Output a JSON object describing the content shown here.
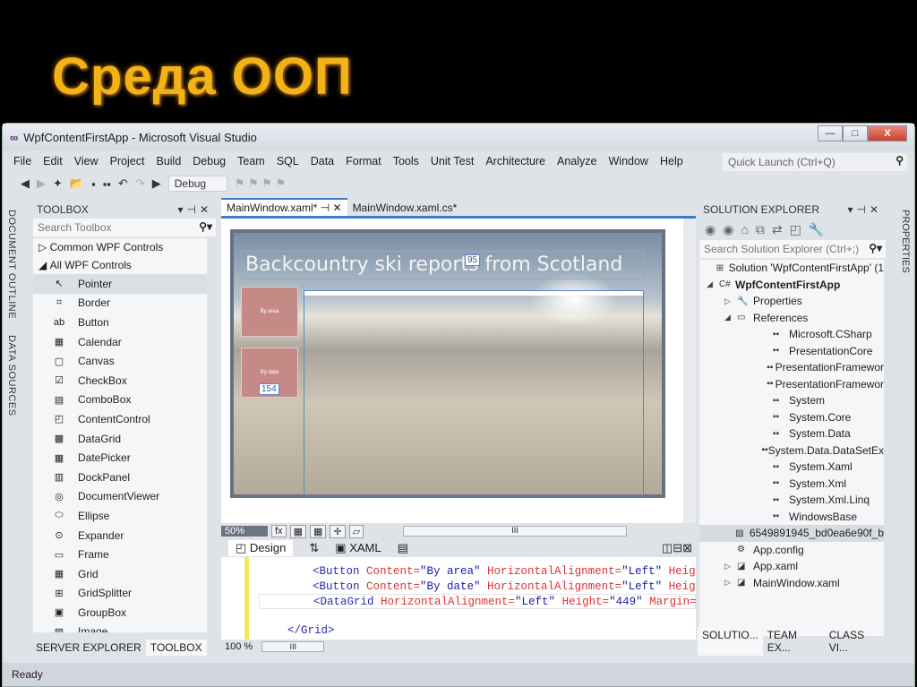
{
  "slide": {
    "title": "Среда ООП"
  },
  "window": {
    "title": "WpfContentFirstApp - Microsoft Visual Studio",
    "minimize": "—",
    "maximize": "□",
    "close": "X"
  },
  "menu": [
    "File",
    "Edit",
    "View",
    "Project",
    "Build",
    "Debug",
    "Team",
    "SQL",
    "Data",
    "Format",
    "Tools",
    "Unit Test",
    "Architecture",
    "Analyze",
    "Window",
    "Help"
  ],
  "quick_launch": {
    "placeholder": "Quick Launch (Ctrl+Q)"
  },
  "toolbar": {
    "config": "Debug"
  },
  "left_vtabs": [
    "DOCUMENT OUTLINE",
    "DATA SOURCES"
  ],
  "toolbox": {
    "title": "TOOLBOX",
    "search_placeholder": "Search Toolbox",
    "groups": [
      "Common WPF Controls",
      "All WPF Controls"
    ],
    "items": [
      {
        "label": "Pointer",
        "icon": "↖"
      },
      {
        "label": "Border",
        "icon": "⌗"
      },
      {
        "label": "Button",
        "icon": "ab"
      },
      {
        "label": "Calendar",
        "icon": "▦"
      },
      {
        "label": "Canvas",
        "icon": "▢"
      },
      {
        "label": "CheckBox",
        "icon": "☑"
      },
      {
        "label": "ComboBox",
        "icon": "▤"
      },
      {
        "label": "ContentControl",
        "icon": "◰"
      },
      {
        "label": "DataGrid",
        "icon": "▩"
      },
      {
        "label": "DatePicker",
        "icon": "▦"
      },
      {
        "label": "DockPanel",
        "icon": "▥"
      },
      {
        "label": "DocumentViewer",
        "icon": "◎"
      },
      {
        "label": "Ellipse",
        "icon": "⬭"
      },
      {
        "label": "Expander",
        "icon": "⊙"
      },
      {
        "label": "Frame",
        "icon": "▭"
      },
      {
        "label": "Grid",
        "icon": "▦"
      },
      {
        "label": "GridSplitter",
        "icon": "⊞"
      },
      {
        "label": "GroupBox",
        "icon": "▣"
      },
      {
        "label": "Image",
        "icon": "▨"
      }
    ],
    "bottom_tabs": [
      "SERVER EXPLORER",
      "TOOLBOX"
    ]
  },
  "editor": {
    "tabs": [
      "MainWindow.xaml*",
      "MainWindow.xaml.cs*"
    ],
    "design": {
      "heading": "Backcountry ski reports from Scotland",
      "buttons": [
        "By area",
        "By date"
      ],
      "adorner_top": "95",
      "adorner_left": "154"
    },
    "zoom": "50%",
    "design_tab": "Design",
    "xaml_tab": "XAML",
    "code_zoom": "100 %",
    "code": [
      {
        "tag": "<Button",
        "a1": " Content=",
        "v1": "\"By area\"",
        "a2": " HorizontalAlignment=",
        "v2": "\"Left\"",
        "a3": " Heigh"
      },
      {
        "tag": "<Button",
        "a1": " Content=",
        "v1": "\"By date\"",
        "a2": " HorizontalAlignment=",
        "v2": "\"Left\"",
        "a3": " Heigh"
      },
      {
        "tag": "<DataGrid",
        "a1": " HorizontalAlignment=",
        "v1": "\"Left\"",
        "a2": " Height=",
        "v2": "\"449\"",
        "a3": " Margin='"
      }
    ],
    "close_tag": "</Grid>"
  },
  "solution_explorer": {
    "title": "SOLUTION EXPLORER",
    "search_placeholder": "Search Solution Explorer (Ctrl+;)",
    "nodes": [
      {
        "label": "Solution 'WpfContentFirstApp' (1",
        "level": 0,
        "arrow": "",
        "icon": "⊞"
      },
      {
        "label": "WpfContentFirstApp",
        "level": 0,
        "arrow": "◢",
        "icon": "C#",
        "bold": true
      },
      {
        "label": "Properties",
        "level": 1,
        "arrow": "▷",
        "icon": "🔧"
      },
      {
        "label": "References",
        "level": 1,
        "arrow": "◢",
        "icon": "▭"
      },
      {
        "label": "Microsoft.CSharp",
        "level": 2,
        "icon": "▪▪"
      },
      {
        "label": "PresentationCore",
        "level": 2,
        "icon": "▪▪"
      },
      {
        "label": "PresentationFramewor",
        "level": 2,
        "icon": "▪▪"
      },
      {
        "label": "PresentationFramewor",
        "level": 2,
        "icon": "▪▪"
      },
      {
        "label": "System",
        "level": 2,
        "icon": "▪▪"
      },
      {
        "label": "System.Core",
        "level": 2,
        "icon": "▪▪"
      },
      {
        "label": "System.Data",
        "level": 2,
        "icon": "▪▪"
      },
      {
        "label": "System.Data.DataSetEx",
        "level": 2,
        "icon": "▪▪"
      },
      {
        "label": "System.Xaml",
        "level": 2,
        "icon": "▪▪"
      },
      {
        "label": "System.Xml",
        "level": 2,
        "icon": "▪▪"
      },
      {
        "label": "System.Xml.Linq",
        "level": 2,
        "icon": "▪▪"
      },
      {
        "label": "WindowsBase",
        "level": 2,
        "icon": "▪▪"
      },
      {
        "label": "6549891945_bd0ea6e90f_b",
        "level": 1,
        "icon": "▨",
        "selected": true
      },
      {
        "label": "App.config",
        "level": 1,
        "icon": "⚙"
      },
      {
        "label": "App.xaml",
        "level": 1,
        "arrow": "▷",
        "icon": "◪"
      },
      {
        "label": "MainWindow.xaml",
        "level": 1,
        "arrow": "▷",
        "icon": "◪"
      }
    ],
    "bottom_tabs": [
      "SOLUTIO...",
      "TEAM EX...",
      "CLASS VI..."
    ]
  },
  "right_vtab": "PROPERTIES",
  "status": "Ready"
}
